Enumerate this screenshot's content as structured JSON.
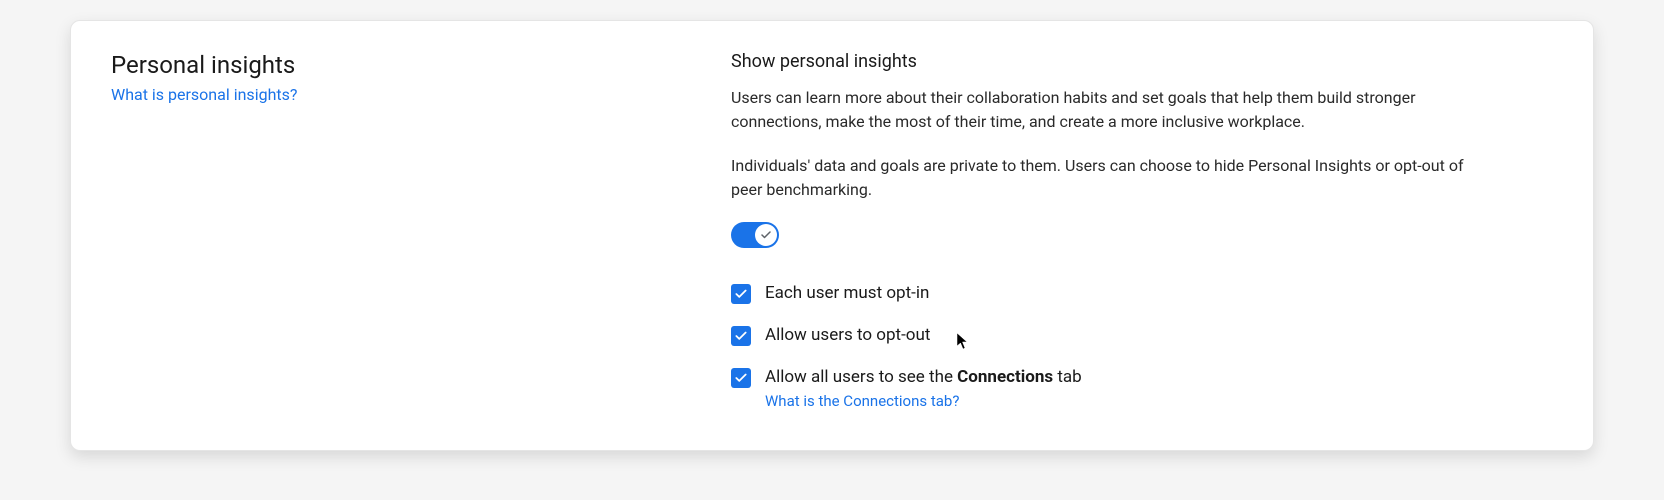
{
  "left": {
    "title": "Personal insights",
    "help_link": "What is personal insights?"
  },
  "right": {
    "subtitle": "Show personal insights",
    "description1": "Users can learn more about their collaboration habits and set goals that help them build stronger connections, make the most of their time, and create a more inclusive workplace.",
    "description2": "Individuals' data and goals are private to them. Users can choose to hide Personal Insights or opt-out of peer benchmarking.",
    "toggle_on": true,
    "options": [
      {
        "label_pre": "Each user must opt-in",
        "label_bold": "",
        "label_post": "",
        "checked": true,
        "sub_link": ""
      },
      {
        "label_pre": "Allow users to opt-out",
        "label_bold": "",
        "label_post": "",
        "checked": true,
        "sub_link": ""
      },
      {
        "label_pre": "Allow all users to see the ",
        "label_bold": "Connections",
        "label_post": " tab",
        "checked": true,
        "sub_link": "What is the Connections tab?"
      }
    ]
  }
}
